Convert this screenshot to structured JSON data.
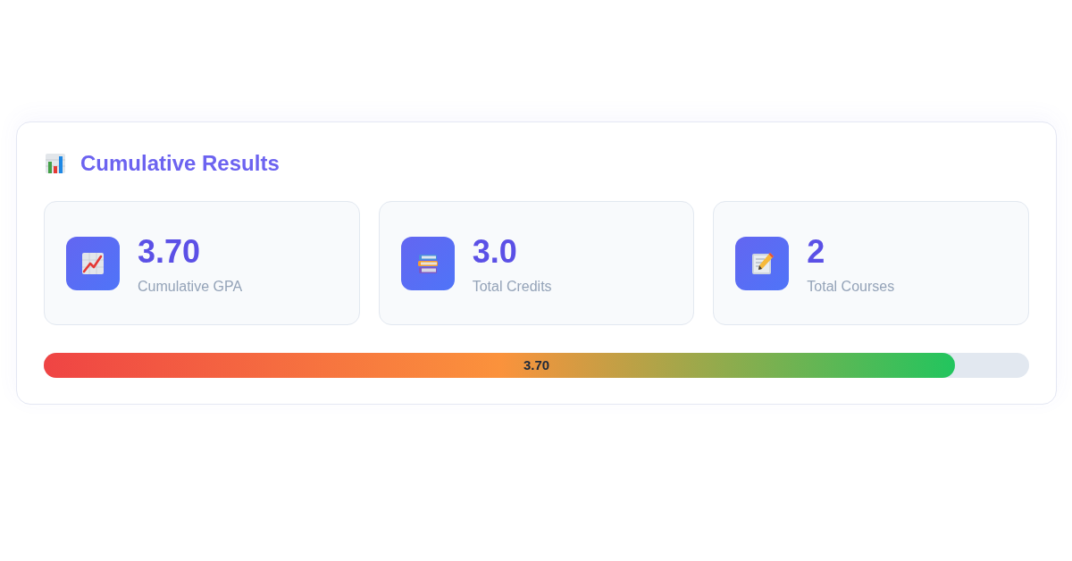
{
  "section": {
    "title": "Cumulative Results"
  },
  "stats": [
    {
      "kind": "gpa",
      "value": "3.70",
      "label": "Cumulative GPA"
    },
    {
      "kind": "credits",
      "value": "3.0",
      "label": "Total Credits"
    },
    {
      "kind": "courses",
      "value": "2",
      "label": "Total Courses"
    }
  ],
  "gpa_bar": {
    "level": 0.925,
    "reading": "3.70"
  }
}
